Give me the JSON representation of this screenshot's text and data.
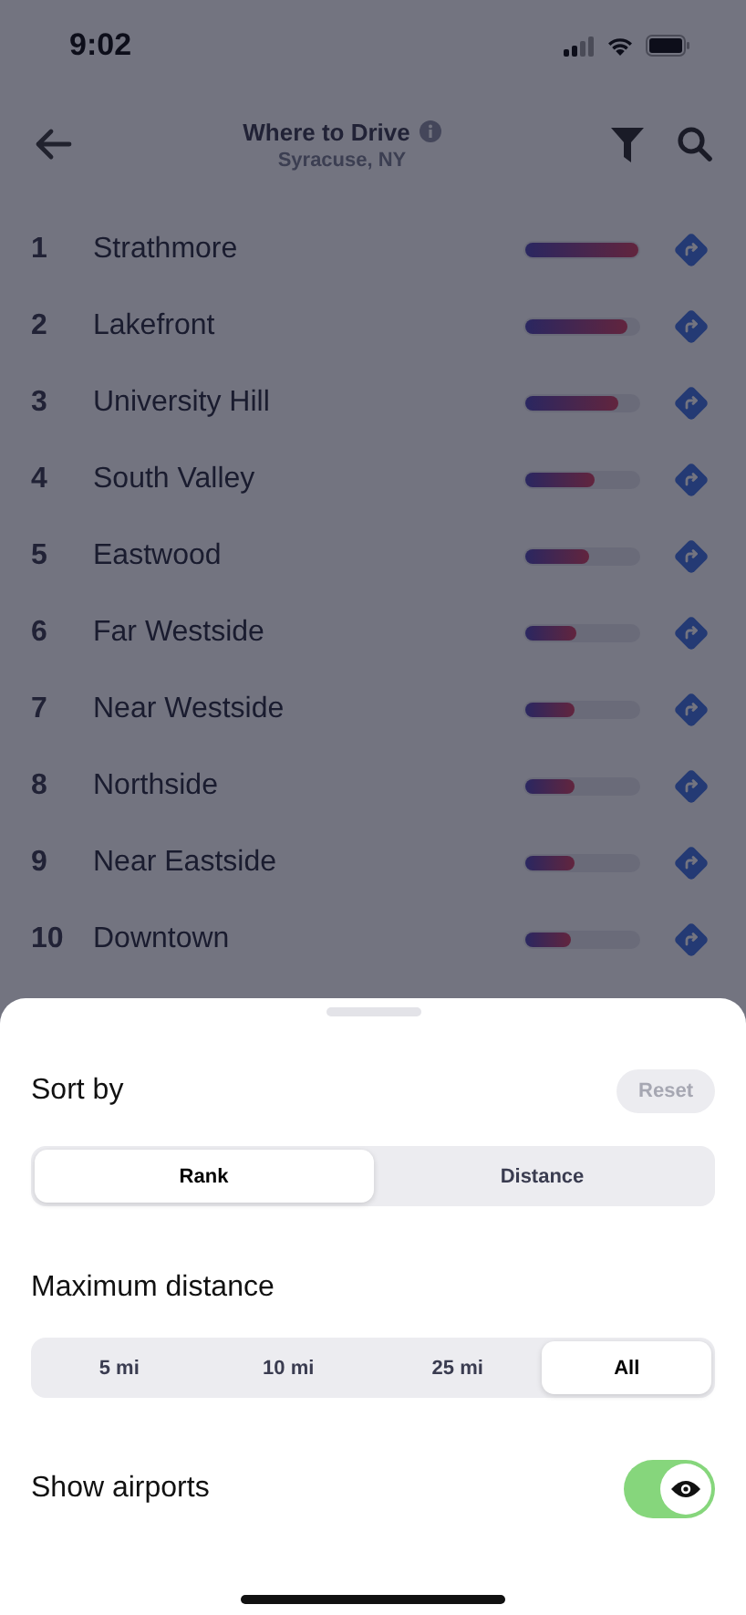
{
  "status_bar": {
    "time": "9:02"
  },
  "header": {
    "title": "Where to Drive",
    "subtitle": "Syracuse, NY"
  },
  "rows": [
    {
      "rank": "1",
      "name": "Strathmore",
      "level": 1.0
    },
    {
      "rank": "2",
      "name": "Lakefront",
      "level": 0.9
    },
    {
      "rank": "3",
      "name": "University Hill",
      "level": 0.83
    },
    {
      "rank": "4",
      "name": "South Valley",
      "level": 0.62
    },
    {
      "rank": "5",
      "name": "Eastwood",
      "level": 0.57
    },
    {
      "rank": "6",
      "name": "Far Westside",
      "level": 0.45
    },
    {
      "rank": "7",
      "name": "Near Westside",
      "level": 0.44
    },
    {
      "rank": "8",
      "name": "Northside",
      "level": 0.44
    },
    {
      "rank": "9",
      "name": "Near Eastside",
      "level": 0.43
    },
    {
      "rank": "10",
      "name": "Downtown",
      "level": 0.4
    }
  ],
  "sheet": {
    "sort_by": {
      "label": "Sort by",
      "reset": {
        "label": "Reset",
        "disabled": true
      },
      "options": [
        {
          "label": "Rank",
          "selected": true
        },
        {
          "label": "Distance",
          "selected": false
        }
      ]
    },
    "max_distance": {
      "label": "Maximum distance",
      "options": [
        {
          "label": "5 mi",
          "selected": false
        },
        {
          "label": "10 mi",
          "selected": false
        },
        {
          "label": "25 mi",
          "selected": false
        },
        {
          "label": "All",
          "selected": true
        }
      ]
    },
    "show_airports": {
      "label": "Show airports",
      "on": true
    }
  }
}
